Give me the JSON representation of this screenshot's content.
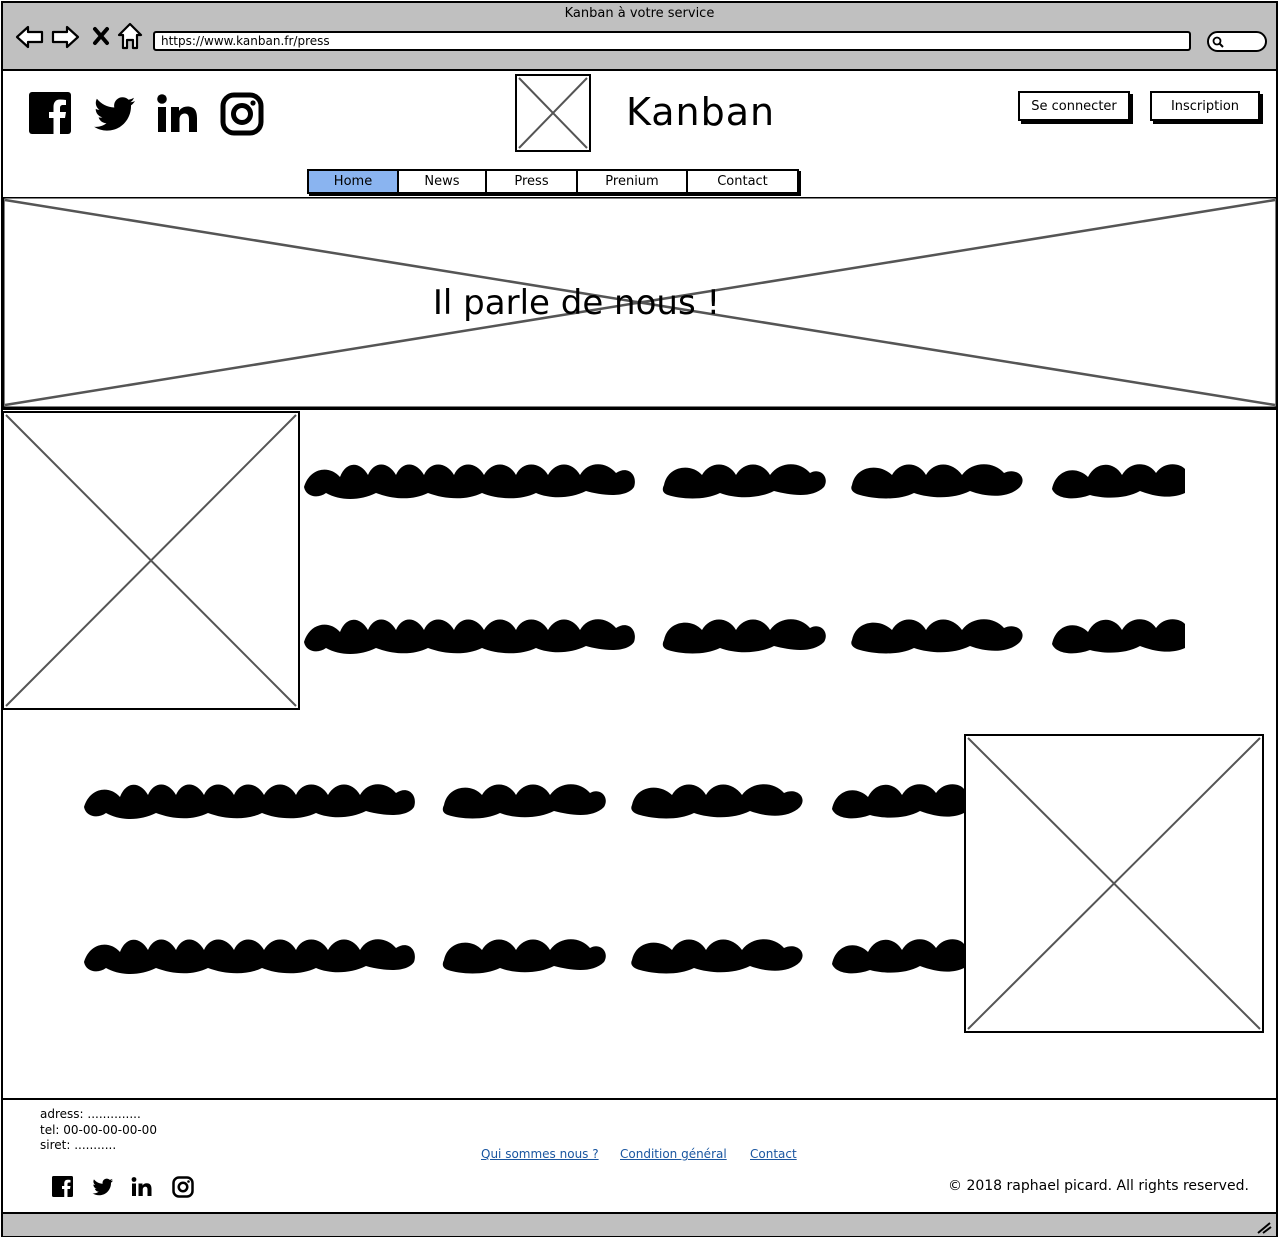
{
  "browser": {
    "window_title": "Kanban à votre service",
    "url": "https://www.kanban.fr/press",
    "icons": [
      "back-icon",
      "forward-icon",
      "close-icon",
      "home-icon",
      "search-icon",
      "resize-grip-icon"
    ]
  },
  "header": {
    "social_icons": [
      "facebook-icon",
      "twitter-icon",
      "linkedin-icon",
      "instagram-icon"
    ],
    "brand_name": "Kanban",
    "buttons": {
      "login": "Se connecter",
      "signup": "Inscription"
    }
  },
  "nav": {
    "tabs": [
      {
        "label": "Home",
        "active": true
      },
      {
        "label": "News",
        "active": false
      },
      {
        "label": "Press",
        "active": false
      },
      {
        "label": "Prenium",
        "active": false
      },
      {
        "label": "Contact",
        "active": false
      }
    ],
    "active_color": "#8ab4f0"
  },
  "hero": {
    "heading": "Il parle de nous !"
  },
  "footer": {
    "address": "adress: ..............",
    "tel": "tel: 00-00-00-00-00",
    "siret": "siret: ...........",
    "links": [
      "Qui sommes nous ?",
      "Condition général",
      "Contact"
    ],
    "social_icons": [
      "facebook-icon",
      "twitter-icon",
      "linkedin-icon",
      "instagram-icon"
    ],
    "copyright": "© 2018 raphael picard. All rights reserved."
  },
  "colors": {
    "chrome_gray": "#c0c0c0",
    "link_blue": "#1a56a0",
    "placeholder_stroke": "#555555"
  }
}
